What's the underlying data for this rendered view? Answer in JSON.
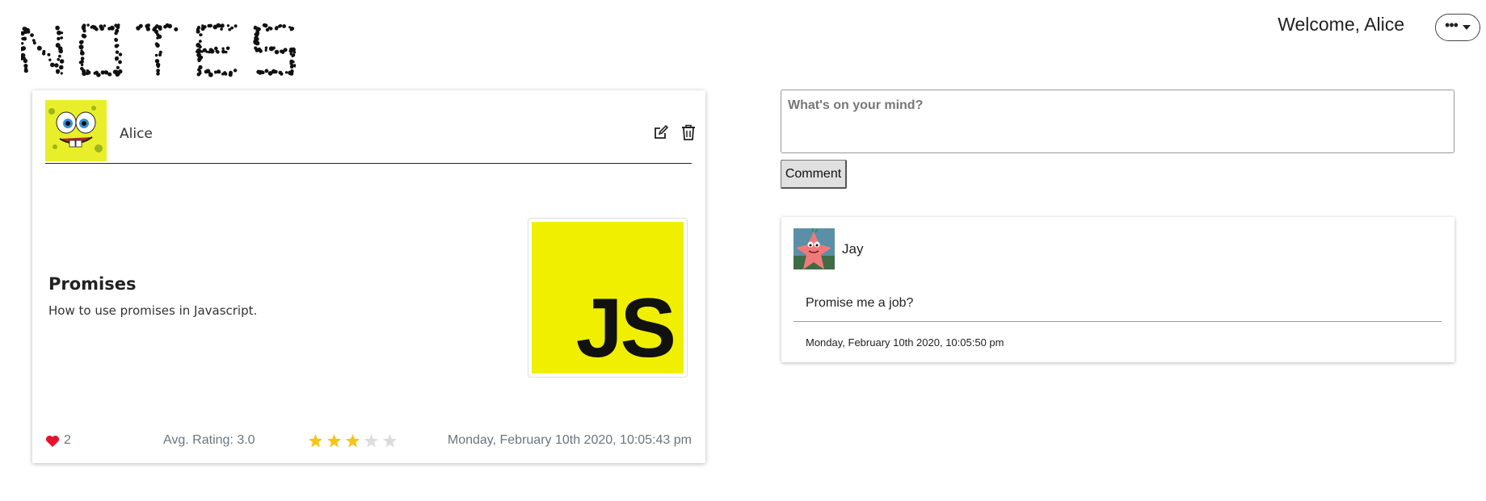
{
  "header": {
    "logo_text": "NOTES",
    "welcome": "Welcome, Alice",
    "menu_icon": "ellipsis-dropdown-icon"
  },
  "note": {
    "author": "Alice",
    "title": "Promises",
    "description": "How to use promises in Javascript.",
    "image_text": "JS",
    "likes": "2",
    "avg_rating": "Avg. Rating: 3.0",
    "rating": 3,
    "rating_max": 5,
    "date": "Monday, February 10th 2020, 10:05:43 pm",
    "colors": {
      "image_bg": "#f0ef00",
      "heart": "#e8112d",
      "star_on": "#f5c518",
      "star_off": "#dddddd"
    }
  },
  "comment_form": {
    "placeholder": "What's on your mind?",
    "button_label": "Comment"
  },
  "comments": [
    {
      "author": "Jay",
      "text": "Promise me a job?",
      "date": "Monday, February 10th 2020, 10:05:50 pm"
    }
  ]
}
